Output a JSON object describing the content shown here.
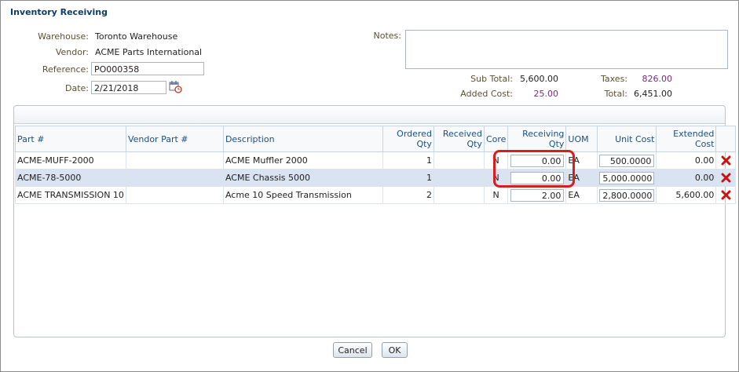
{
  "window": {
    "title": "Inventory Receiving"
  },
  "header": {
    "warehouse_label": "Warehouse:",
    "warehouse_value": "Toronto Warehouse",
    "vendor_label": "Vendor:",
    "vendor_value": "ACME Parts International",
    "reference_label": "Reference:",
    "reference_value": "PO000358",
    "date_label": "Date:",
    "date_value": "2/21/2018",
    "notes_label": "Notes:",
    "notes_value": ""
  },
  "totals": {
    "subtotal_label": "Sub Total:",
    "subtotal_value": "5,600.00",
    "taxes_label": "Taxes:",
    "taxes_value": "826.00",
    "added_cost_label": "Added Cost:",
    "added_cost_value": "25.00",
    "total_label": "Total:",
    "total_value": "6,451.00"
  },
  "table": {
    "columns": {
      "part": "Part #",
      "vendor_part": "Vendor Part #",
      "description": "Description",
      "ordered_qty": "Ordered Qty",
      "received_qty": "Received Qty",
      "core": "Core",
      "receiving_qty": "Receiving Qty",
      "uom": "UOM",
      "unit_cost": "Unit Cost",
      "extended_cost": "Extended Cost"
    },
    "rows": [
      {
        "part": "ACME-MUFF-2000",
        "vendor_part": "",
        "description": "ACME Muffler 2000",
        "ordered_qty": "1",
        "received_qty": "",
        "core": "N",
        "receiving_qty": "0.00",
        "uom": "EA",
        "unit_cost": "500.0000",
        "extended_cost": "0.00"
      },
      {
        "part": "ACME-78-5000",
        "vendor_part": "",
        "description": "ACME Chassis 5000",
        "ordered_qty": "1",
        "received_qty": "",
        "core": "N",
        "receiving_qty": "0.00",
        "uom": "EA",
        "unit_cost": "5,000.0000",
        "extended_cost": "0.00"
      },
      {
        "part": "ACME TRANSMISSION 10",
        "vendor_part": "",
        "description": "Acme 10 Speed Transmission",
        "ordered_qty": "2",
        "received_qty": "",
        "core": "N",
        "receiving_qty": "2.00",
        "uom": "EA",
        "unit_cost": "2,800.0000",
        "extended_cost": "5,600.00"
      }
    ],
    "selected_row": 1
  },
  "buttons": {
    "cancel": "Cancel",
    "ok": "OK"
  },
  "icons": {
    "calendar": "calendar-icon",
    "delete": "delete-x-icon"
  },
  "colors": {
    "title": "#0b3d66",
    "header_text": "#1b4f80",
    "highlight": "#d61f1f",
    "delete": "#cc1111",
    "selected_row": "#d9e3f1"
  }
}
